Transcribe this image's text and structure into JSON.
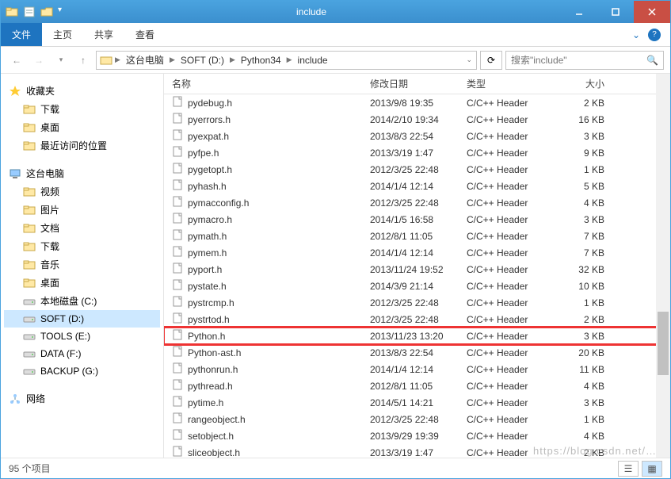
{
  "window": {
    "title": "include"
  },
  "ribbon": {
    "file": "文件",
    "tabs": [
      "主页",
      "共享",
      "查看"
    ]
  },
  "breadcrumbs": [
    "这台电脑",
    "SOFT (D:)",
    "Python34",
    "include"
  ],
  "search": {
    "placeholder": "搜索\"include\""
  },
  "sidebar": {
    "favorites": {
      "label": "收藏夹",
      "items": [
        "下载",
        "桌面",
        "最近访问的位置"
      ]
    },
    "thispc": {
      "label": "这台电脑",
      "items": [
        "视频",
        "图片",
        "文档",
        "下载",
        "音乐",
        "桌面",
        "本地磁盘 (C:)",
        "SOFT (D:)",
        "TOOLS (E:)",
        "DATA (F:)",
        "BACKUP (G:)"
      ],
      "selected": 7
    },
    "network": {
      "label": "网络"
    }
  },
  "columns": {
    "name": "名称",
    "date": "修改日期",
    "type": "类型",
    "size": "大小"
  },
  "type_label": "C/C++ Header",
  "highlight": "Python.h",
  "files": [
    {
      "name": "pydebug.h",
      "date": "2013/9/8 19:35",
      "size": "2 KB"
    },
    {
      "name": "pyerrors.h",
      "date": "2014/2/10 19:34",
      "size": "16 KB"
    },
    {
      "name": "pyexpat.h",
      "date": "2013/8/3 22:54",
      "size": "3 KB"
    },
    {
      "name": "pyfpe.h",
      "date": "2013/3/19 1:47",
      "size": "9 KB"
    },
    {
      "name": "pygetopt.h",
      "date": "2012/3/25 22:48",
      "size": "1 KB"
    },
    {
      "name": "pyhash.h",
      "date": "2014/1/4 12:14",
      "size": "5 KB"
    },
    {
      "name": "pymacconfig.h",
      "date": "2012/3/25 22:48",
      "size": "4 KB"
    },
    {
      "name": "pymacro.h",
      "date": "2014/1/5 16:58",
      "size": "3 KB"
    },
    {
      "name": "pymath.h",
      "date": "2012/8/1 11:05",
      "size": "7 KB"
    },
    {
      "name": "pymem.h",
      "date": "2014/1/4 12:14",
      "size": "7 KB"
    },
    {
      "name": "pyport.h",
      "date": "2013/11/24 19:52",
      "size": "32 KB"
    },
    {
      "name": "pystate.h",
      "date": "2014/3/9 21:14",
      "size": "10 KB"
    },
    {
      "name": "pystrcmp.h",
      "date": "2012/3/25 22:48",
      "size": "1 KB"
    },
    {
      "name": "pystrtod.h",
      "date": "2012/3/25 22:48",
      "size": "2 KB"
    },
    {
      "name": "Python.h",
      "date": "2013/11/23 13:20",
      "size": "3 KB"
    },
    {
      "name": "Python-ast.h",
      "date": "2013/8/3 22:54",
      "size": "20 KB"
    },
    {
      "name": "pythonrun.h",
      "date": "2014/1/4 12:14",
      "size": "11 KB"
    },
    {
      "name": "pythread.h",
      "date": "2012/8/1 11:05",
      "size": "4 KB"
    },
    {
      "name": "pytime.h",
      "date": "2014/5/1 14:21",
      "size": "3 KB"
    },
    {
      "name": "rangeobject.h",
      "date": "2012/3/25 22:48",
      "size": "1 KB"
    },
    {
      "name": "setobject.h",
      "date": "2013/9/29 19:39",
      "size": "4 KB"
    },
    {
      "name": "sliceobject.h",
      "date": "2013/3/19 1:47",
      "size": "2 KB"
    }
  ],
  "status": {
    "count": "95 个项目"
  },
  "watermark": "https://blog.csdn.net/…"
}
